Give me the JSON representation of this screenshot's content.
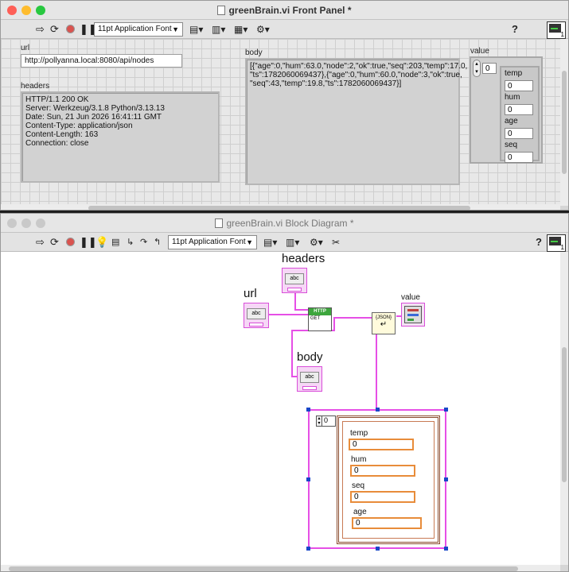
{
  "front_panel": {
    "title": "greenBrain.vi Front Panel *",
    "font_label": "11pt Application Font",
    "help": "?",
    "url_label": "url",
    "url_value": "http://pollyanna.local:8080/api/nodes",
    "headers_label": "headers",
    "headers_lines": [
      "HTTP/1.1 200 OK",
      "Server: Werkzeug/3.1.8 Python/3.13.13",
      "Date: Sun, 21 Jun 2026 16:41:11 GMT",
      "Content-Type: application/json",
      "Content-Length: 163",
      "Connection: close"
    ],
    "body_label": "body",
    "body_lines": [
      "[{\"age\":0,\"hum\":63.0,\"node\":2,\"ok\":true,\"seq\":203,\"temp\":17.0,",
      "\"ts\":1782060069437},{\"age\":0,\"hum\":60.0,\"node\":3,\"ok\":true,",
      "\"seq\":43,\"temp\":19.8,\"ts\":1782060069437}]"
    ],
    "value_label": "value",
    "array_index": "0",
    "cluster_fields": [
      {
        "label": "temp",
        "value": "0"
      },
      {
        "label": "hum",
        "value": "0"
      },
      {
        "label": "age",
        "value": "0"
      },
      {
        "label": "seq",
        "value": "0"
      }
    ],
    "icon_number": "1"
  },
  "block_diagram": {
    "title": "greenBrain.vi Block Diagram *",
    "font_label": "11pt Application Font",
    "help": "?",
    "headers_label": "headers",
    "url_label": "url",
    "body_label": "body",
    "value_label": "value",
    "http_header": "HTTP",
    "http_method": "GET",
    "json_label": "{JSON}",
    "terminal_text": "abc",
    "array_index": "0",
    "cluster_fields": [
      {
        "label": "temp",
        "value": "0"
      },
      {
        "label": "hum",
        "value": "0"
      },
      {
        "label": "seq",
        "value": "0"
      },
      {
        "label": "age",
        "value": "0"
      }
    ],
    "icon_number": "1"
  },
  "colors": {
    "string_wire": "#e64fe6",
    "numeric_field": "#e88c3a",
    "cluster_wire": "#8a4a2c",
    "traffic_close": "#fe5f57",
    "traffic_min": "#febc2e",
    "traffic_max": "#28c840"
  },
  "icons": [
    "run-arrow-icon",
    "run-continuous-icon",
    "abort-icon",
    "pause-icon",
    "align-icon",
    "distribute-icon",
    "resize-icon",
    "reorder-icon",
    "help-icon",
    "highlight-bulb-icon",
    "retain-wire-icon",
    "step-into-icon",
    "step-over-icon",
    "step-out-icon",
    "cleanup-icon",
    "vi-icon"
  ]
}
